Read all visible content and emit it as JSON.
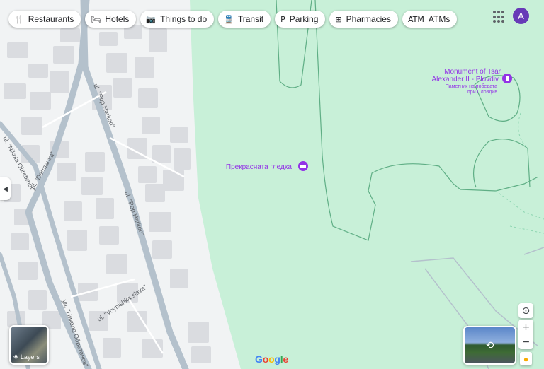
{
  "chips": [
    {
      "icon": "restaurant-icon",
      "glyph": "🍴",
      "label": "Restaurants"
    },
    {
      "icon": "hotel-icon",
      "glyph": "🛏",
      "label": "Hotels"
    },
    {
      "icon": "camera-icon",
      "glyph": "📷",
      "label": "Things to do"
    },
    {
      "icon": "transit-icon",
      "glyph": "🚆",
      "label": "Transit"
    },
    {
      "icon": "parking-icon",
      "glyph": "P",
      "label": "Parking"
    },
    {
      "icon": "pharmacy-icon",
      "glyph": "⊞",
      "label": "Pharmacies"
    },
    {
      "icon": "atm-icon",
      "glyph": "ATM",
      "label": "ATMs"
    }
  ],
  "account": {
    "initial": "A"
  },
  "map": {
    "places": [
      {
        "name": "Прекрасната гледка"
      },
      {
        "name_line1": "Monument of Tsar",
        "name_line2": "Alexander II - Plovdiv",
        "sub_line1": "Паметник на победата",
        "sub_line2": "при Пловдив"
      }
    ],
    "streets": [
      "ul. \"Pop Hariton\"",
      "ul. \"Pop Hariton\"",
      "ul. \"Nikola Obretenov\"",
      "ul. \"Dermanka\"",
      "ul. \"Voynishka slava\"",
      "ул. \"Никола Обретенов\""
    ]
  },
  "layers": {
    "label": "Layers"
  },
  "controls": {
    "zoom_in": "+",
    "zoom_out": "−"
  },
  "colors": {
    "park": "#c8f0d8",
    "road": "#b4c1cc",
    "building": "#dadce0",
    "poi": "#9334e6"
  },
  "logo": [
    "G",
    "o",
    "o",
    "g",
    "l",
    "e"
  ]
}
